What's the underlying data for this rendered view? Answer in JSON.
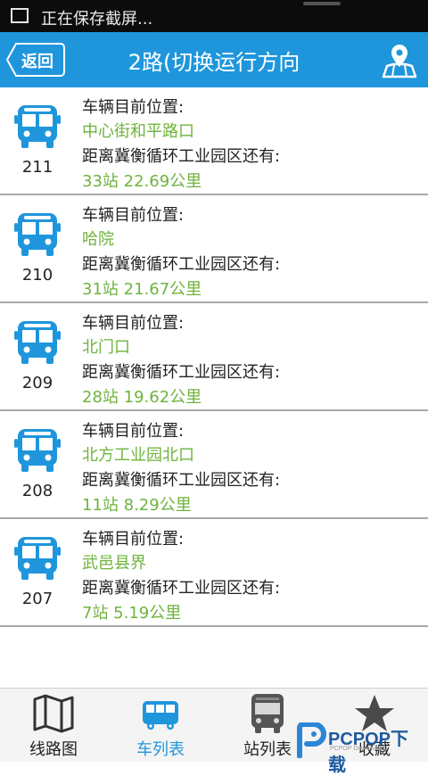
{
  "status_bar": {
    "notification_icon": "image-icon",
    "text": "正在保存截屏..."
  },
  "header": {
    "back_label": "返回",
    "title": "2路(切换运行方向",
    "map_icon": "map-pin-icon",
    "color": "#1f96dc"
  },
  "vehicles": [
    {
      "bus_no": "211",
      "position_label": "车辆目前位置:",
      "location": "中心街和平路口",
      "distance_label": "距离冀衡循环工业园区还有:",
      "remaining": "33站  22.69公里"
    },
    {
      "bus_no": "210",
      "position_label": "车辆目前位置:",
      "location": "哈院",
      "distance_label": "距离冀衡循环工业园区还有:",
      "remaining": "31站  21.67公里"
    },
    {
      "bus_no": "209",
      "position_label": "车辆目前位置:",
      "location": "北门口",
      "distance_label": "距离冀衡循环工业园区还有:",
      "remaining": "28站  19.62公里"
    },
    {
      "bus_no": "208",
      "position_label": "车辆目前位置:",
      "location": "北方工业园北口",
      "distance_label": "距离冀衡循环工业园区还有:",
      "remaining": "11站  8.29公里"
    },
    {
      "bus_no": "207",
      "position_label": "车辆目前位置:",
      "location": "武邑县界",
      "distance_label": "距离冀衡循环工业园区还有:",
      "remaining": "7站  5.19公里"
    }
  ],
  "tabs": [
    {
      "label": "线路图",
      "icon": "map-icon",
      "active": false
    },
    {
      "label": "车列表",
      "icon": "bus-icon",
      "active": true
    },
    {
      "label": "站列表",
      "icon": "bus-front-icon",
      "active": false
    },
    {
      "label": "收藏",
      "icon": "star-icon",
      "active": false
    }
  ],
  "watermark": {
    "text": "PCPOP下载",
    "sub": "PCPOP Download"
  },
  "colors": {
    "accent": "#1f96dc",
    "location_green": "#6fb33c"
  }
}
